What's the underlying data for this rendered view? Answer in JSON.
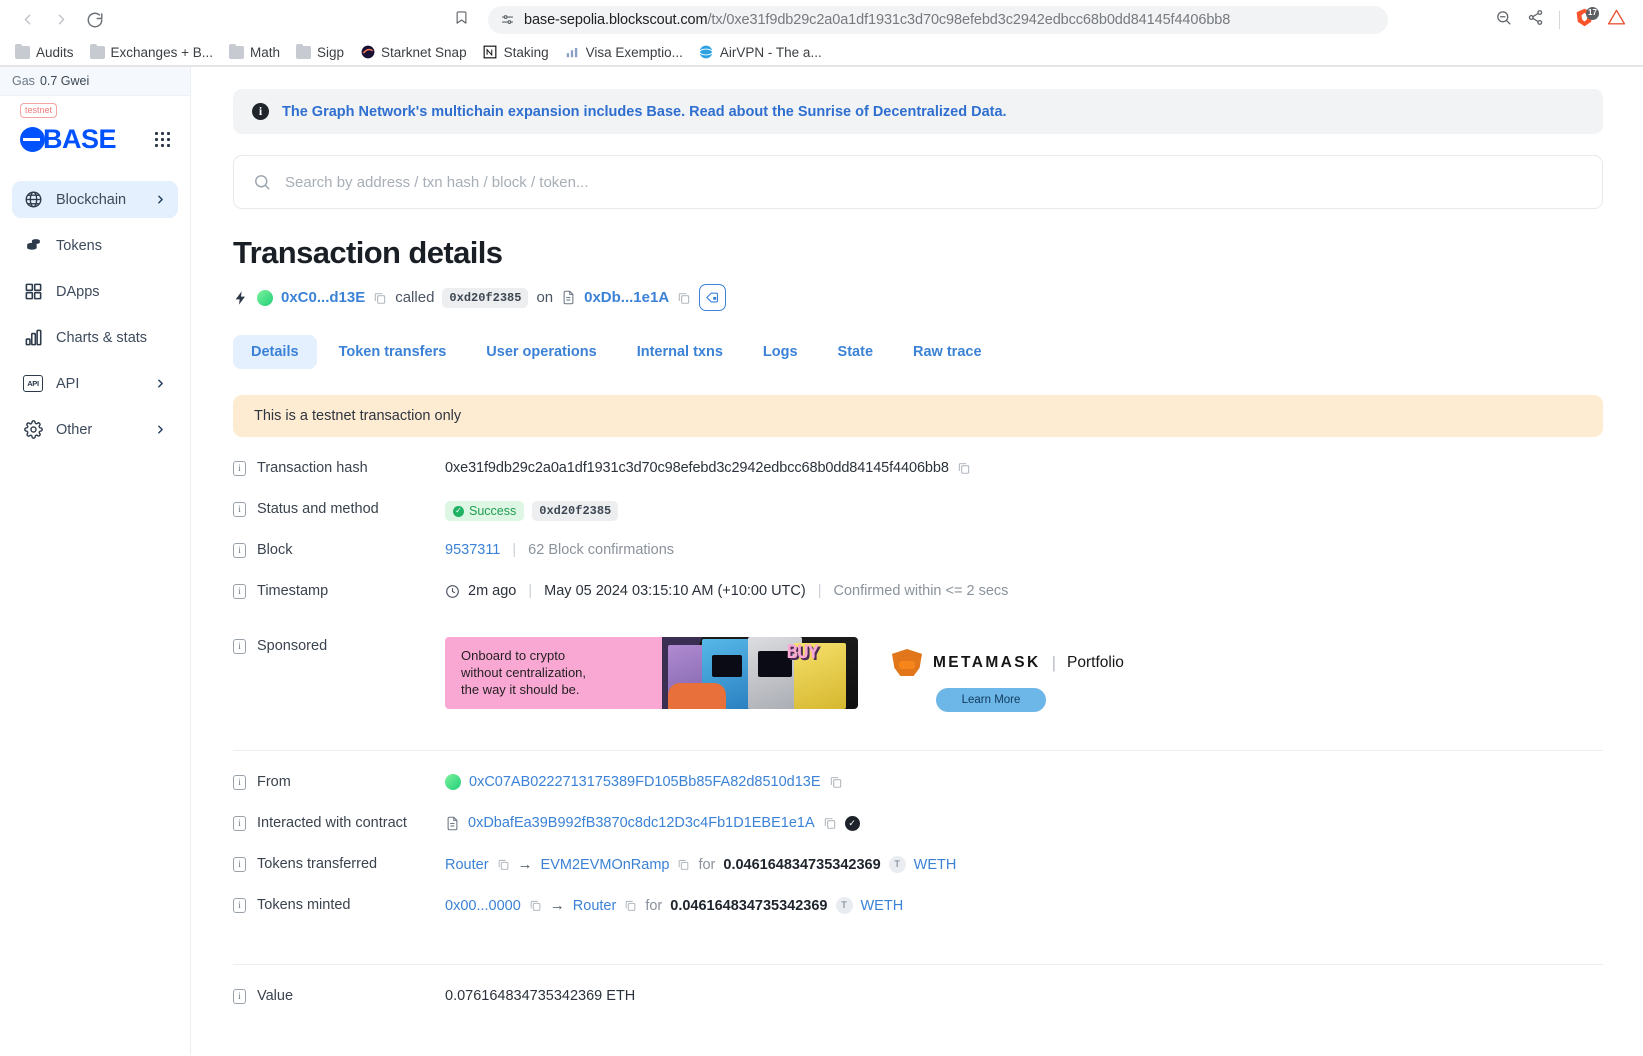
{
  "browser": {
    "back_icon": "back-arrow-icon",
    "forward_icon": "forward-arrow-icon",
    "reload_icon": "reload-icon",
    "bookmark_icon": "bookmark-icon",
    "site_settings_icon": "site-settings-icon",
    "url_domain": "base-sepolia.blockscout.com",
    "url_path": "/tx/0xe31f9db29c2a0a1df1931c3d70c98efebd3c2942edbcc68b0dd84145f4406bb8",
    "zoom_out_icon": "zoom-out-icon",
    "share_icon": "share-icon",
    "brave_shield_badge": "17",
    "extension_icon": "extension-icon",
    "bookmarks": [
      {
        "label": "Audits",
        "icon": "folder-icon"
      },
      {
        "label": "Exchanges + B...",
        "icon": "folder-icon"
      },
      {
        "label": "Math",
        "icon": "folder-icon"
      },
      {
        "label": "Sigp",
        "icon": "folder-icon"
      },
      {
        "label": "Starknet Snap",
        "icon": "starknet-icon"
      },
      {
        "label": "Staking",
        "icon": "notion-icon"
      },
      {
        "label": "Visa Exemptio...",
        "icon": "analytics-icon"
      },
      {
        "label": "AirVPN - The a...",
        "icon": "airvpn-icon"
      }
    ]
  },
  "sidebar": {
    "gas_label": "Gas",
    "gas_value": "0.7 Gwei",
    "testnet_tag": "testnet",
    "brand": "BASE",
    "apps_grid_icon": "apps-grid-icon",
    "items": [
      {
        "label": "Blockchain",
        "icon": "globe-icon",
        "chevron": true,
        "active": true
      },
      {
        "label": "Tokens",
        "icon": "coins-icon",
        "chevron": false,
        "active": false
      },
      {
        "label": "DApps",
        "icon": "grid-icon",
        "chevron": false,
        "active": false
      },
      {
        "label": "Charts & stats",
        "icon": "bars-icon",
        "chevron": false,
        "active": false
      },
      {
        "label": "API",
        "icon": "api-icon",
        "chevron": true,
        "active": false
      },
      {
        "label": "Other",
        "icon": "gear-icon",
        "chevron": true,
        "active": false
      }
    ]
  },
  "main": {
    "graph_banner": {
      "icon": "info-icon",
      "text": "The Graph Network's multichain expansion includes Base. Read about the Sunrise of Decentralized Data."
    },
    "search": {
      "icon": "search-icon",
      "placeholder": "Search by address / txn hash / block / token..."
    },
    "page_title": "Transaction details",
    "subline": {
      "bolt_icon": "bolt-icon",
      "from_address": "0xC0...d13E",
      "called_word": "called",
      "method": "0xd20f2385",
      "on_word": "on",
      "contract_address": "0xDb...1e1A",
      "action_icon": "contract-lock-icon"
    },
    "tabs": [
      {
        "label": "Details",
        "active": true
      },
      {
        "label": "Token transfers",
        "active": false
      },
      {
        "label": "User operations",
        "active": false
      },
      {
        "label": "Internal txns",
        "active": false
      },
      {
        "label": "Logs",
        "active": false
      },
      {
        "label": "State",
        "active": false
      },
      {
        "label": "Raw trace",
        "active": false
      }
    ],
    "testnet_note": "This is a testnet transaction only",
    "rows": {
      "tx_hash_label": "Transaction hash",
      "tx_hash_value": "0xe31f9db29c2a0a1df1931c3d70c98efebd3c2942edbcc68b0dd84145f4406bb8",
      "status_label": "Status and method",
      "status_value": "Success",
      "status_method": "0xd20f2385",
      "block_label": "Block",
      "block_number": "9537311",
      "block_confirmations": "62 Block confirmations",
      "timestamp_label": "Timestamp",
      "timestamp_ago": "2m ago",
      "timestamp_full": "May 05 2024 03:15:10 AM (+10:00 UTC)",
      "timestamp_confirmed": "Confirmed within <= 2 secs",
      "sponsored_label": "Sponsored",
      "from_label": "From",
      "from_value": "0xC07AB0222713175389FD105Bb85FA82d8510d13E",
      "contract_label": "Interacted with contract",
      "contract_value": "0xDbafEa39B992fB3870c8dc12D3c4Fb1D1EBE1e1A",
      "tokens_transferred_label": "Tokens transferred",
      "tokens_transferred_from": "Router",
      "tokens_transferred_to": "EVM2EVMOnRamp",
      "tokens_transferred_for": "for",
      "tokens_transferred_amount": "0.046164834735342369",
      "tokens_transferred_symbol": "WETH",
      "tokens_minted_label": "Tokens minted",
      "tokens_minted_from": "0x00...0000",
      "tokens_minted_to": "Router",
      "tokens_minted_for": "for",
      "tokens_minted_amount": "0.046164834735342369",
      "tokens_minted_symbol": "WETH",
      "value_label": "Value",
      "value_value": "0.076164834735342369 ETH"
    },
    "ad": {
      "line1": "Onboard to crypto",
      "line2": "without centralization,",
      "line3": "the way it should be.",
      "buy_text": "BUY",
      "metamask_word": "METAMASK",
      "metamask_divider": "|",
      "metamask_portfolio": "Portfolio",
      "learn_more": "Learn More"
    }
  },
  "colors": {
    "accent_blue": "#3b82d6",
    "base_blue": "#0052ff",
    "success_green": "#1f9d51",
    "testnet_amber": "#fdecd2",
    "ad_pink": "#f9a8d4"
  }
}
